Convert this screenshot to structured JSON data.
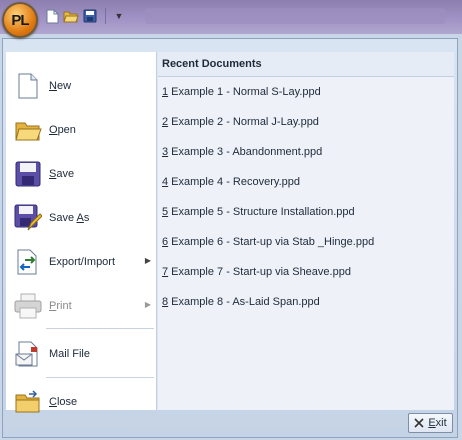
{
  "app": {
    "orb_label": "PL"
  },
  "quick_access": [
    {
      "name": "new-document-icon"
    },
    {
      "name": "open-folder-icon"
    },
    {
      "name": "save-icon"
    }
  ],
  "menu": {
    "items": [
      {
        "label_pre": "",
        "label_u": "N",
        "label_post": "ew",
        "icon": "new-document-icon"
      },
      {
        "label_pre": "",
        "label_u": "O",
        "label_post": "pen",
        "icon": "open-folder-icon"
      },
      {
        "label_pre": "",
        "label_u": "S",
        "label_post": "ave",
        "icon": "save-icon"
      },
      {
        "label_pre": "Save ",
        "label_u": "A",
        "label_post": "s",
        "icon": "save-as-icon"
      },
      {
        "label_pre": "Export/Import",
        "label_u": "",
        "label_post": "",
        "icon": "export-import-icon"
      },
      {
        "label_pre": "",
        "label_u": "P",
        "label_post": "rint",
        "icon": "printer-icon"
      },
      {
        "label_pre": "Mail File",
        "label_u": "",
        "label_post": "",
        "icon": "mail-file-icon"
      },
      {
        "label_pre": "",
        "label_u": "C",
        "label_post": "lose",
        "icon": "close-folder-icon"
      }
    ]
  },
  "recent": {
    "header": "Recent Documents",
    "documents": [
      {
        "num": "1",
        "name": " Example 1 - Normal S-Lay.ppd"
      },
      {
        "num": "2",
        "name": " Example 2 - Normal J-Lay.ppd"
      },
      {
        "num": "3",
        "name": " Example 3 - Abandonment.ppd"
      },
      {
        "num": "4",
        "name": " Example 4 - Recovery.ppd"
      },
      {
        "num": "5",
        "name": " Example 5 - Structure Installation.ppd"
      },
      {
        "num": "6",
        "name": " Example 6 - Start-up via Stab _Hinge.ppd"
      },
      {
        "num": "7",
        "name": " Example 7 - Start-up via Sheave.ppd"
      },
      {
        "num": "8",
        "name": " Example 8 - As-Laid Span.ppd"
      }
    ]
  },
  "exit": {
    "label_u": "E",
    "label_post": "xit"
  }
}
